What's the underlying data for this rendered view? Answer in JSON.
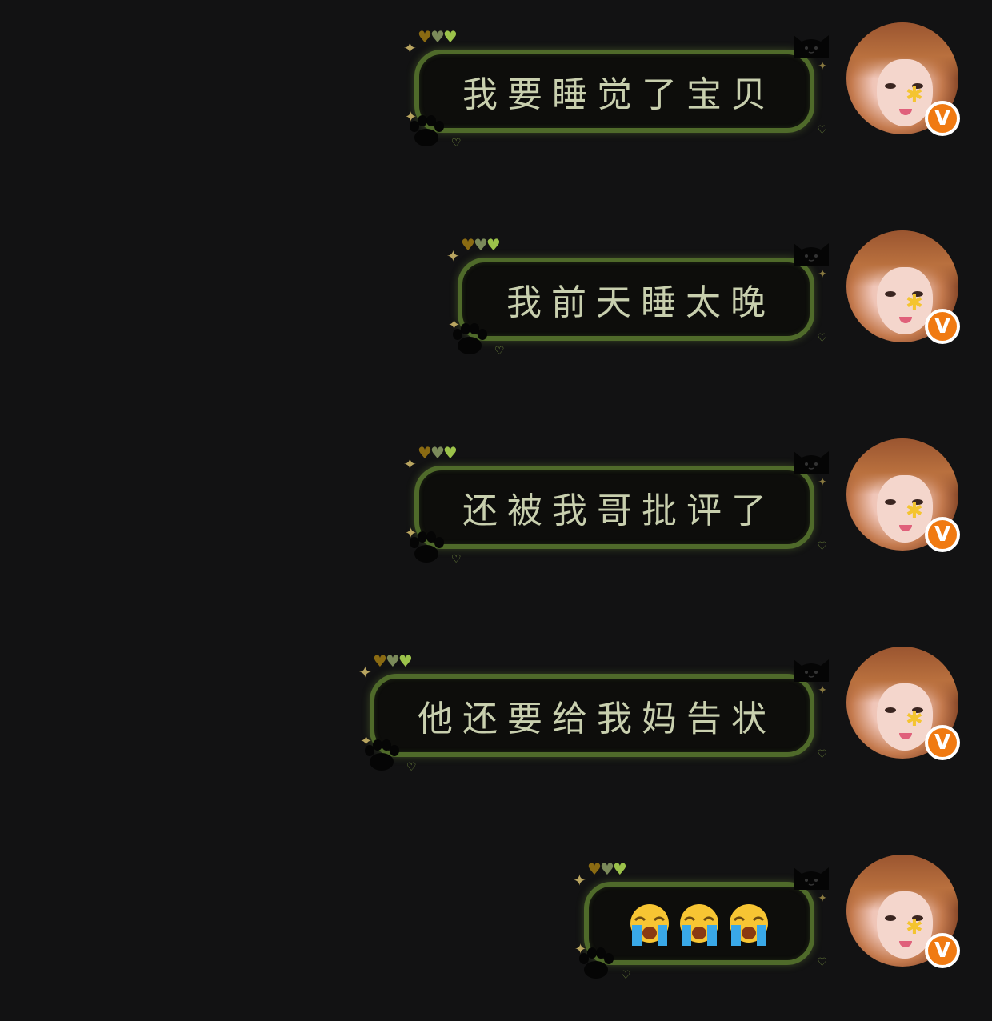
{
  "messages": [
    {
      "text": "我要睡觉了宝贝",
      "type": "text"
    },
    {
      "text": "我前天睡太晚",
      "type": "text"
    },
    {
      "text": "还被我哥批评了",
      "type": "text"
    },
    {
      "text": "他还要给我妈告状",
      "type": "text"
    },
    {
      "text": "",
      "type": "emoji",
      "emoji_name": "loudly-crying-face",
      "emoji_count": 3
    }
  ],
  "avatar": {
    "badge": "V"
  },
  "decor": {
    "hearts": [
      "♥",
      "♥",
      "♥"
    ],
    "sparkle": "✦",
    "small_sparkle": "✦",
    "mini_heart": "♡",
    "flower": "✱"
  },
  "colors": {
    "background": "#121213",
    "bubble_border": "#4f6a2a",
    "bubble_fill": "#0d0d0b",
    "text": "#c8cfae",
    "badge": "#f07a12"
  }
}
